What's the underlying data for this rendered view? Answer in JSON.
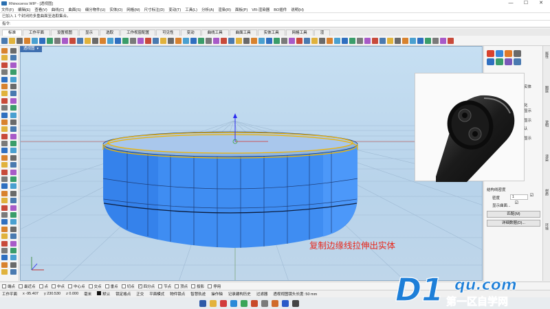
{
  "window": {
    "title": "Rhinoceros WIP - [透视图]",
    "controls": [
      "—",
      "☐",
      "✕"
    ]
  },
  "menu": [
    "文件(F)",
    "编辑(E)",
    "查看(V)",
    "曲线(C)",
    "曲面(S)",
    "细分物件(U)",
    "实体(O)",
    "网格(M)",
    "尺寸标注(D)",
    "变动(T)",
    "工具(L)",
    "分析(A)",
    "渲染(R)",
    "面板(P)",
    "VR-渲染器",
    "BO插件",
    "说明(H)"
  ],
  "command": {
    "history": "已加入 1 个封闭的多重曲面至选取集合。",
    "prompt": "指令:"
  },
  "tabs": [
    "标准",
    "工作平面",
    "设置视图",
    "显示",
    "选取",
    "工作视窗配置",
    "可见性",
    "变动",
    "曲线工具",
    "曲面工具",
    "实体工具",
    "网格工具",
    "渲"
  ],
  "viewport": {
    "name": "透视图",
    "menu_arrow": "▾",
    "caption": "复制边缘线拉伸出实体"
  },
  "right_panel": {
    "labels": [
      "实体",
      "化",
      "显示",
      "显示",
      "认",
      "显示",
      "结构线密度"
    ],
    "density_label": "密度",
    "density_value": "1",
    "show_curves_label": "显示曲面...",
    "check_mark": "☑",
    "match_button": "匹配(M)",
    "details_button": "详细数据(D)..."
  },
  "side_tabs": [
    "属性",
    "图层",
    "说明",
    "渲染",
    "材质",
    "环境"
  ],
  "osnaps": [
    {
      "label": "端点",
      "checked": false
    },
    {
      "label": "最近点",
      "checked": false
    },
    {
      "label": "点",
      "checked": false
    },
    {
      "label": "中点",
      "checked": false
    },
    {
      "label": "中心点",
      "checked": false
    },
    {
      "label": "交点",
      "checked": false
    },
    {
      "label": "垂点",
      "checked": false
    },
    {
      "label": "切点",
      "checked": false
    },
    {
      "label": "四分点",
      "checked": true
    },
    {
      "label": "节点",
      "checked": false
    },
    {
      "label": "顶点",
      "checked": false
    },
    {
      "label": "投影",
      "checked": false
    },
    {
      "label": "停用",
      "checked": false
    }
  ],
  "status": {
    "cplane": "工作平面",
    "x": "x -95.407",
    "y": "y 230.530",
    "z": "z 0.000",
    "unit": "毫米",
    "layer": "默认",
    "toggles": [
      "锁定格点",
      "正交",
      "平面模式",
      "物件锁点",
      "智慧轨迹",
      "操作轴",
      "记录建构历史",
      "过滤器"
    ],
    "message": "透视视图镜头长度: 50 mm"
  },
  "colors": {
    "object": "#3d8ef5",
    "selection": "#f0b400",
    "viewport_bg": "#bcd6ee",
    "caption": "#e8281c",
    "watermark": "#1e7fd8"
  },
  "watermark": {
    "brand": "D1",
    "domain": "qu.com",
    "slogan": "第一区自学网"
  }
}
